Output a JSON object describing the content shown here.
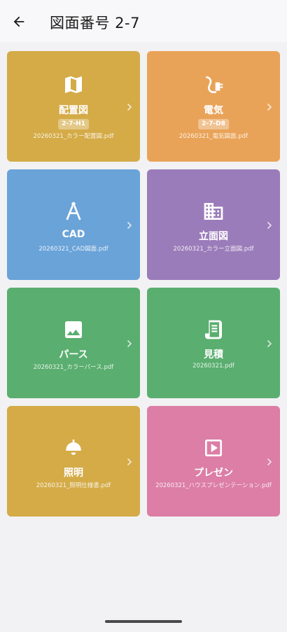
{
  "header": {
    "title": "図面番号 2-7",
    "back_icon": "arrow-left-icon"
  },
  "cards": [
    {
      "label": "配置図",
      "badge": "2-7-H1",
      "file": "20260321_カラー配置図.pdf",
      "color": "#d4ab47",
      "icon": "map-icon"
    },
    {
      "label": "電気",
      "badge": "2-7-D8",
      "file": "20260321_電気図面.pdf",
      "color": "#e9a358",
      "icon": "power-plug-icon"
    },
    {
      "label": "CAD",
      "badge": "",
      "file": "20260321_CAD図面.pdf",
      "color": "#6aa3d8",
      "icon": "compass-icon"
    },
    {
      "label": "立面図",
      "badge": "",
      "file": "20260321_カラー立面図.pdf",
      "color": "#9b7cba",
      "icon": "building-icon"
    },
    {
      "label": "パース",
      "badge": "",
      "file": "20260321_カラーパース.pdf",
      "color": "#5aae6f",
      "icon": "image-icon"
    },
    {
      "label": "見積",
      "badge": "",
      "file": "20260321.pdf",
      "color": "#5aae6f",
      "icon": "receipt-icon"
    },
    {
      "label": "照明",
      "badge": "",
      "file": "20260321_照明仕様書.pdf",
      "color": "#d4ab47",
      "icon": "ceiling-lamp-icon"
    },
    {
      "label": "プレゼン",
      "badge": "",
      "file": "20260321_ハウスプレゼンテーション.pdf",
      "color": "#dc7ea6",
      "icon": "play-box-icon"
    }
  ]
}
